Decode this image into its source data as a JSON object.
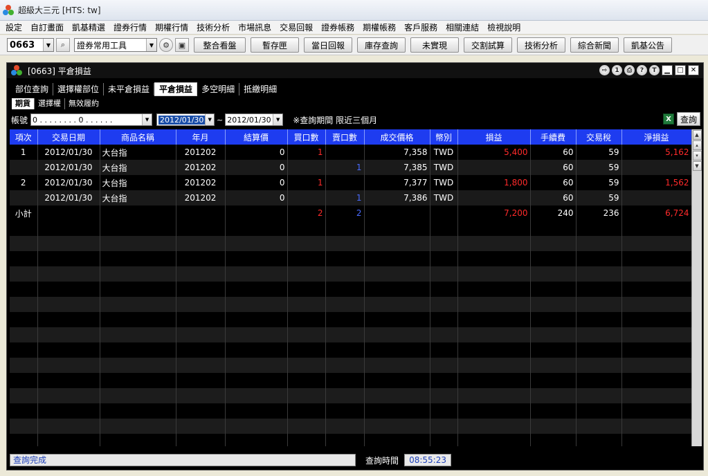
{
  "window": {
    "title": "超級大三元  [HTS: tw]"
  },
  "menu": [
    "設定",
    "自訂畫面",
    "凱基精選",
    "證券行情",
    "期權行情",
    "技術分析",
    "市場訊息",
    "交易回報",
    "證券帳務",
    "期權帳務",
    "客戶服務",
    "相關連結",
    "檢視說明"
  ],
  "toolbar": {
    "code_value": "0663",
    "tool_select": "證券常用工具",
    "buttons": [
      "整合看盤",
      "暫存匣",
      "當日回報",
      "庫存查詢",
      "未實現",
      "交割試算",
      "技術分析",
      "綜合新聞",
      "凱基公告"
    ]
  },
  "inner_window": {
    "title": "[0663] 平倉損益",
    "title_icons": [
      "1",
      "?",
      "T"
    ]
  },
  "tabs": {
    "main": [
      "部位查詢",
      "選擇權部位",
      "未平倉損益",
      "平倉損益",
      "多空明細",
      "抵繳明細"
    ],
    "main_active": 3,
    "sub": [
      "期貨",
      "選擇權",
      "無效履約"
    ],
    "sub_active": 0
  },
  "filter": {
    "account_label": "帳號",
    "account_value": "0 . . . . . . . . 0 . . . . . .",
    "date_from": "2012/01/30",
    "tilde": "~",
    "date_to": "2012/01/30",
    "note": "※查詢期間 限近三個月",
    "query_label": "查詢"
  },
  "grid": {
    "columns": [
      "項次",
      "交易日期",
      "商品名稱",
      "年月",
      "結算價",
      "買口數",
      "賣口數",
      "成交價格",
      "幣別",
      "損益",
      "手續費",
      "交易稅",
      "淨損益"
    ],
    "rows": [
      [
        "1",
        "2012/01/30",
        "大台指",
        "201202",
        "0",
        "1",
        "",
        "7,358",
        "TWD",
        "5,400",
        "60",
        "59",
        "5,162"
      ],
      [
        "",
        "2012/01/30",
        "大台指",
        "201202",
        "0",
        "",
        "1",
        "7,385",
        "TWD",
        "",
        "60",
        "59",
        ""
      ],
      [
        "2",
        "2012/01/30",
        "大台指",
        "201202",
        "0",
        "1",
        "",
        "7,377",
        "TWD",
        "1,800",
        "60",
        "59",
        "1,562"
      ],
      [
        "",
        "2012/01/30",
        "大台指",
        "201202",
        "0",
        "",
        "1",
        "7,386",
        "TWD",
        "",
        "60",
        "59",
        ""
      ],
      [
        "小計",
        "",
        "",
        "",
        "",
        "2",
        "2",
        "",
        "",
        "7,200",
        "240",
        "236",
        "6,724"
      ]
    ]
  },
  "status": {
    "message": "查詢完成",
    "time_label": "查詢時間",
    "time_value": "08:55:23"
  },
  "colors": {
    "header_bg": "#1e3cf0",
    "positive": "#ff2a2a",
    "sell": "#4a6bff",
    "status_text": "#1c3fb8"
  }
}
